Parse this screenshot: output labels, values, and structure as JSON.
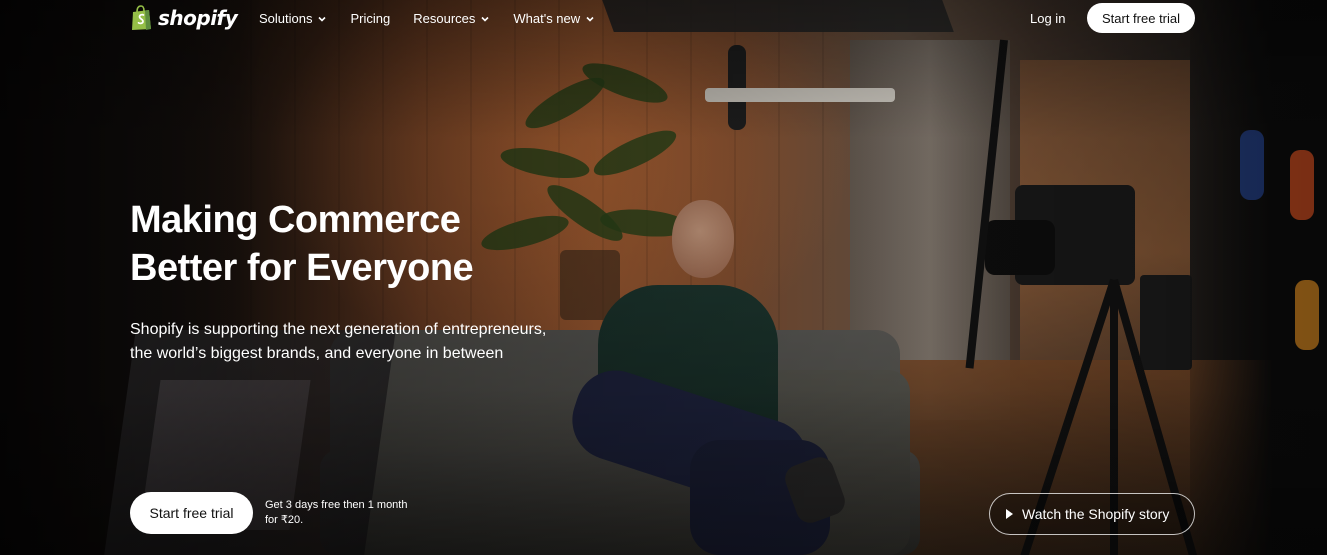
{
  "header": {
    "logo_text": "shopify",
    "nav": [
      {
        "label": "Solutions",
        "has_dropdown": true
      },
      {
        "label": "Pricing",
        "has_dropdown": false
      },
      {
        "label": "Resources",
        "has_dropdown": true
      },
      {
        "label": "What's new",
        "has_dropdown": true
      }
    ],
    "login_label": "Log in",
    "cta_label": "Start free trial"
  },
  "hero": {
    "title_lines": [
      "Making Commerce",
      "Better for Everyone"
    ],
    "subtitle_lines": [
      "Shopify is supporting the next generation of entrepreneurs,",
      "the world’s biggest brands, and everyone in between"
    ],
    "cta_label": "Start free trial",
    "trial_note_lines": [
      "Get 3 days free then 1 month",
      "for ₹20."
    ],
    "watch_label": "Watch the Shopify story"
  },
  "colors": {
    "brand_green": "#95bf47",
    "button_bg": "#ffffff",
    "button_text": "#111111"
  },
  "icons": {
    "logo": "shopify-bag-icon",
    "dropdown": "chevron-down-icon",
    "watch": "play-icon"
  }
}
